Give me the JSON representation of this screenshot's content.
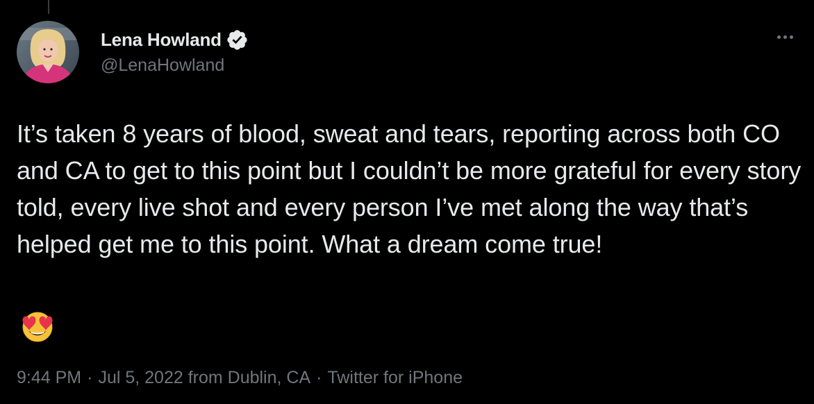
{
  "tweet": {
    "author": {
      "display_name": "Lena Howland",
      "handle": "@LenaHowland",
      "verified": true,
      "avatar_icon": "avatar-photo"
    },
    "more_icon": "more-horizontal-icon",
    "text": "It’s taken 8 years of blood, sweat and tears, reporting across both CO and CA to get to this point but I couldn’t be more grateful for every story told, every live shot and every person I’ve met along the way that’s helped get me to this point. What a dream come true!",
    "emoji": "smiling-face-with-heart-eyes",
    "meta": {
      "time": "9:44 PM",
      "separator": "·",
      "date_location": "Jul 5, 2022 from Dublin, CA",
      "source": "Twitter for iPhone"
    }
  },
  "colors": {
    "background": "#000000",
    "text_primary": "#e7e9ea",
    "text_secondary": "#71767b",
    "verified_badge": "#e7e9ea"
  }
}
